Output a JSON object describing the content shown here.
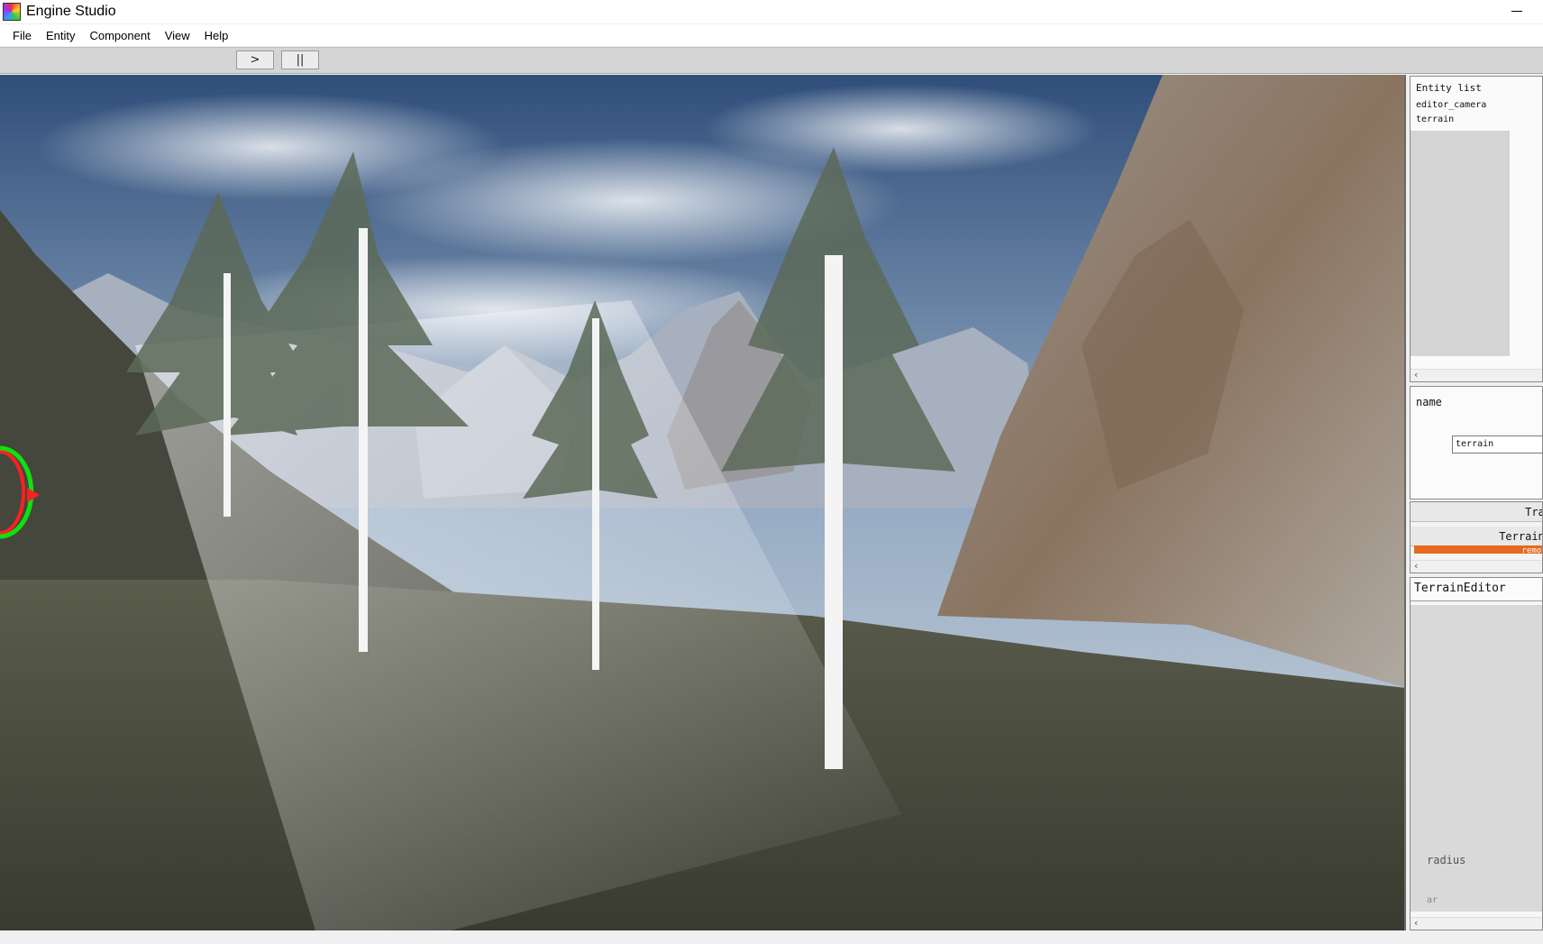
{
  "window": {
    "title": "Engine Studio"
  },
  "menu": {
    "items": [
      "File",
      "Entity",
      "Component",
      "View",
      "Help"
    ]
  },
  "toolbar": {
    "play_label": ">",
    "pause_label": "||"
  },
  "entity_list": {
    "title": "Entity list",
    "items": [
      "editor_camera",
      "terrain"
    ]
  },
  "inspector": {
    "name_label": "name",
    "name_value": "terrain"
  },
  "components": {
    "items": [
      "Tran",
      "TerrainC"
    ],
    "remove_label": "remove"
  },
  "terrain_editor": {
    "title": "TerrainEditor",
    "radius_label": "radius",
    "extra_label": "ar"
  },
  "colors": {
    "accent_remove": "#e66a1e",
    "gizmo_red": "#ff2020",
    "gizmo_green": "#10e010"
  },
  "icons": [
    "app-icon",
    "minimize-icon",
    "play-icon",
    "pause-icon",
    "chevron-left-icon"
  ]
}
